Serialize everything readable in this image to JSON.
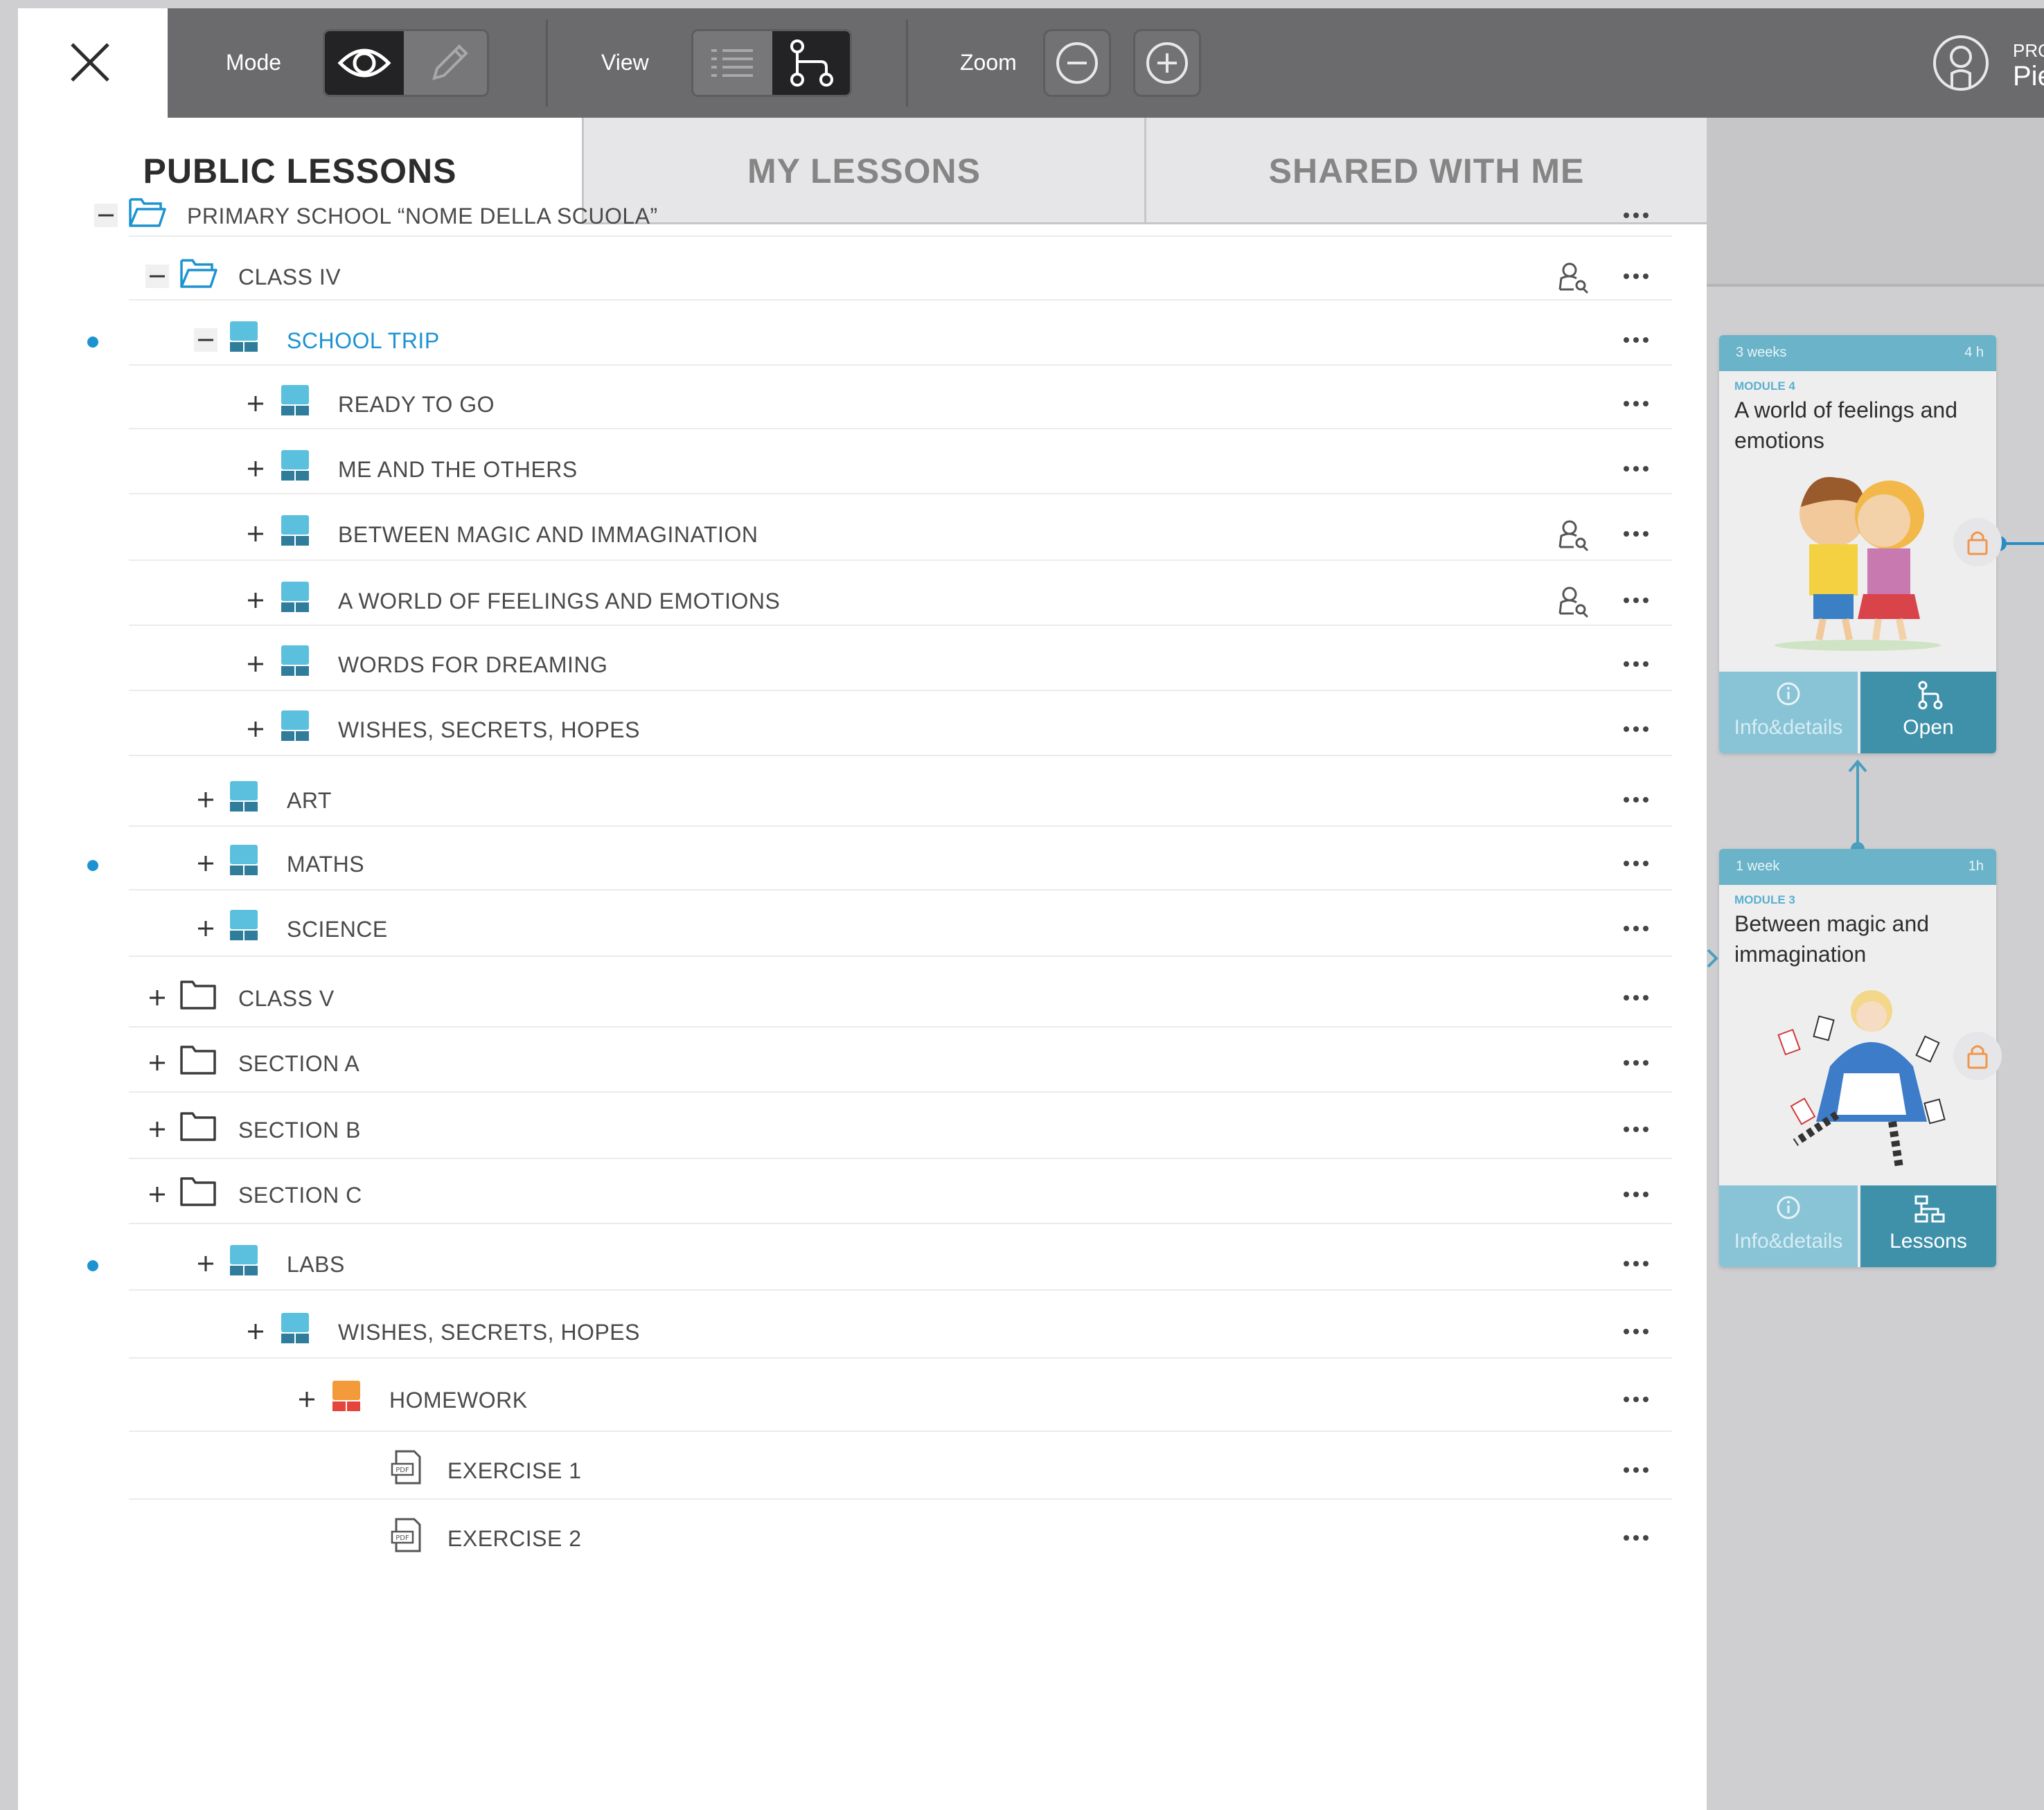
{
  "toolbar": {
    "mode_label": "Mode",
    "view_label": "View",
    "zoom_label": "Zoom",
    "profile_label": "PRO",
    "user_name": "Pie"
  },
  "tabs": [
    {
      "label": "PUBLIC LESSONS",
      "active": true
    },
    {
      "label": "MY LESSONS",
      "active": false
    },
    {
      "label": "SHARED WITH ME",
      "active": false
    }
  ],
  "tree": [
    {
      "label": "PRIMARY SCHOOL “NOME DELLA SCUOLA”",
      "icon": "folder-open-icon",
      "toggle": "minus",
      "depth": 0
    },
    {
      "label": "CLASS IV",
      "icon": "folder-open-icon",
      "toggle": "minus",
      "depth": 1,
      "shared": true
    },
    {
      "label": "SCHOOL TRIP",
      "icon": "lesson-blue-icon",
      "toggle": "minus",
      "depth": 2,
      "dot": true,
      "highlight": true
    },
    {
      "label": "READY TO GO",
      "icon": "lesson-blue-icon",
      "toggle": "plus",
      "depth": 3
    },
    {
      "label": "ME AND THE OTHERS",
      "icon": "lesson-blue-icon",
      "toggle": "plus",
      "depth": 3
    },
    {
      "label": "BETWEEN MAGIC AND IMMAGINATION",
      "icon": "lesson-blue-icon",
      "toggle": "plus",
      "depth": 3,
      "shared": true
    },
    {
      "label": "A WORLD OF FEELINGS AND EMOTIONS",
      "icon": "lesson-blue-icon",
      "toggle": "plus",
      "depth": 3,
      "shared": true
    },
    {
      "label": "WORDS FOR DREAMING",
      "icon": "lesson-blue-icon",
      "toggle": "plus",
      "depth": 3
    },
    {
      "label": "WISHES, SECRETS, HOPES",
      "icon": "lesson-blue-icon",
      "toggle": "plus",
      "depth": 3
    },
    {
      "label": "ART",
      "icon": "lesson-blue-icon",
      "toggle": "plus",
      "depth": 2
    },
    {
      "label": "MATHS",
      "icon": "lesson-blue-icon",
      "toggle": "plus",
      "depth": 2,
      "dot": true
    },
    {
      "label": "SCIENCE",
      "icon": "lesson-blue-icon",
      "toggle": "plus",
      "depth": 2
    },
    {
      "label": "CLASS V",
      "icon": "folder-icon",
      "toggle": "plus",
      "depth": 1
    },
    {
      "label": "SECTION A",
      "icon": "folder-icon",
      "toggle": "plus",
      "depth": 1
    },
    {
      "label": "SECTION B",
      "icon": "folder-icon",
      "toggle": "plus",
      "depth": 1
    },
    {
      "label": "SECTION C",
      "icon": "folder-icon",
      "toggle": "plus",
      "depth": 1
    },
    {
      "label": "LABS",
      "icon": "lesson-blue-icon",
      "toggle": "plus",
      "depth": 2,
      "dot": true
    },
    {
      "label": "WISHES, SECRETS, HOPES",
      "icon": "lesson-blue-icon",
      "toggle": "plus",
      "depth": 3
    },
    {
      "label": "HOMEWORK",
      "icon": "lesson-orange-icon",
      "toggle": "plus",
      "depth": 4
    },
    {
      "label": "EXERCISE 1",
      "icon": "pdf-icon",
      "toggle": "none",
      "depth": 5
    },
    {
      "label": "EXERCISE 2",
      "icon": "pdf-icon",
      "toggle": "none",
      "depth": 5
    }
  ],
  "cards": [
    {
      "duration": "3 weeks",
      "hours": "4 h",
      "module": "MODULE 4",
      "title": "A world of feelings and emotions",
      "info_label": "Info&details",
      "action_label": "Open",
      "action_icon": "map-icon"
    },
    {
      "duration": "1 week",
      "hours": "1h",
      "module": "MODULE 3",
      "title": "Between magic and immagination",
      "info_label": "Info&details",
      "action_label": "Lessons",
      "action_icon": "hierarchy-icon"
    }
  ],
  "colors": {
    "toolbar_bg": "#6b6b6d",
    "accent_blue": "#1c93d1",
    "lesson_blue": "#5bc0de",
    "lesson_dark": "#2f7d9a",
    "homework_orange": "#f39a3a",
    "homework_red": "#e5453b",
    "card_header": "#6ab3c8",
    "card_action": "#3f91aa"
  }
}
